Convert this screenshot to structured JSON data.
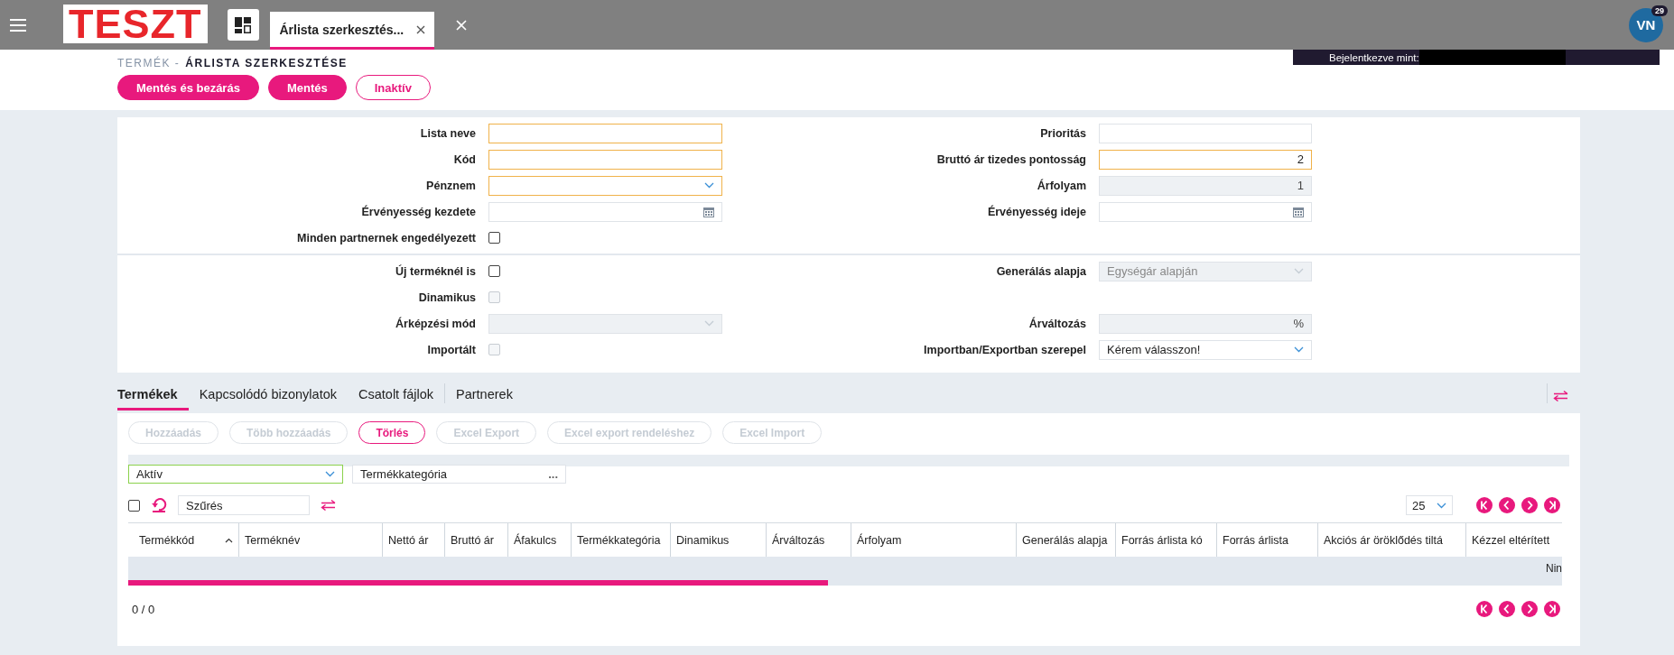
{
  "header": {
    "logo": "TESZT",
    "tabs": [
      {
        "label": "Árlista szerkesztés...",
        "selected": true
      }
    ],
    "avatar": "VN",
    "badge": "29",
    "logged_in_label": "Bejelentkezve mint:"
  },
  "breadcrumb": {
    "parent": "TERMÉK -",
    "current": "ÁRLISTA SZERKESZTÉSE"
  },
  "actions": [
    {
      "label": "Mentés és bezárás",
      "kind": "primary"
    },
    {
      "label": "Mentés",
      "kind": "primary"
    },
    {
      "label": "Inaktív",
      "kind": "outline"
    }
  ],
  "form_sections": [
    [
      [
        {
          "label": "Lista neve",
          "kind": "text",
          "required": true,
          "disabled": false
        },
        {
          "label": "Prioritás",
          "kind": "text",
          "required": false,
          "disabled": false
        }
      ],
      [
        {
          "label": "Kód",
          "kind": "text",
          "required": true,
          "disabled": false
        },
        {
          "label": "Bruttó ár tizedes pontosság",
          "kind": "text",
          "value": "2",
          "required": true,
          "disabled": false
        }
      ],
      [
        {
          "label": "Pénznem",
          "kind": "select",
          "required": true,
          "disabled": false
        },
        {
          "label": "Árfolyam",
          "kind": "text",
          "value": "1",
          "required": false,
          "disabled": true
        }
      ],
      [
        {
          "label": "Érvényesség kezdete",
          "kind": "date",
          "required": false,
          "disabled": false
        },
        {
          "label": "Érvényesség ideje",
          "kind": "date",
          "required": false,
          "disabled": false
        }
      ],
      [
        {
          "label": "Minden partnernek engedélyezett",
          "kind": "checkbox",
          "checked": false,
          "disabled": false
        }
      ]
    ],
    [
      [
        {
          "label": "Új terméknél is",
          "kind": "checkbox",
          "checked": false,
          "disabled": false
        },
        {
          "label": "Generálás alapja",
          "kind": "select",
          "value": "Egységár alapján",
          "required": false,
          "disabled": true
        }
      ],
      [
        {
          "label": "Dinamikus",
          "kind": "checkbox",
          "checked": false,
          "disabled": true
        }
      ],
      [
        {
          "label": "Árképzési mód",
          "kind": "select",
          "required": false,
          "disabled": true
        },
        {
          "label": "Árváltozás",
          "kind": "text",
          "value": "%",
          "required": false,
          "disabled": true
        }
      ],
      [
        {
          "label": "Importált",
          "kind": "checkbox",
          "checked": false,
          "disabled": true
        },
        {
          "label": "Importban/Exportban szerepel",
          "kind": "select",
          "value": "Kérem válasszon!",
          "required": false,
          "disabled": false
        }
      ]
    ]
  ],
  "detail_tabs": [
    {
      "label": "Termékek",
      "selected": true
    },
    {
      "label": "Kapcsolódó bizonylatok",
      "selected": false
    },
    {
      "label": "Csatolt fájlok",
      "selected": false
    },
    {
      "label": "Partnerek",
      "selected": false
    }
  ],
  "toolbar": [
    {
      "label": "Hozzáadás",
      "disabled": true
    },
    {
      "label": "Több hozzáadás",
      "disabled": true
    },
    {
      "label": "Törlés",
      "disabled": false
    },
    {
      "label": "Excel Export",
      "disabled": true
    },
    {
      "label": "Excel export rendeléshez",
      "disabled": true
    },
    {
      "label": "Excel Import",
      "disabled": true
    }
  ],
  "filters": {
    "status": "Aktív",
    "category_placeholder": "Termékkategória",
    "category_button": "...",
    "search_placeholder": "Szűrés",
    "select_all_checked": false
  },
  "page_size": "25",
  "table": {
    "columns": [
      {
        "label": "Termékkód",
        "sorted": true
      },
      {
        "label": "Terméknév",
        "sorted": false
      },
      {
        "label": "Nettó ár",
        "sorted": false
      },
      {
        "label": "Bruttó ár",
        "sorted": false
      },
      {
        "label": "Áfakulcs",
        "sorted": false
      },
      {
        "label": "Termékkategória",
        "sorted": false
      },
      {
        "label": "Dinamikus",
        "sorted": false
      },
      {
        "label": "Árváltozás",
        "sorted": false
      },
      {
        "label": "Árfolyam",
        "sorted": false
      },
      {
        "label": "Generálás alapja",
        "sorted": false
      },
      {
        "label": "Forrás árlista kó",
        "sorted": false
      },
      {
        "label": "Forrás árlista",
        "sorted": false
      },
      {
        "label": "Akciós ár öröklődés tiltá",
        "sorted": false
      },
      {
        "label": "Kézzel eltérített",
        "sorted": false
      }
    ],
    "empty_text": "Nin"
  },
  "pager": "0 / 0"
}
